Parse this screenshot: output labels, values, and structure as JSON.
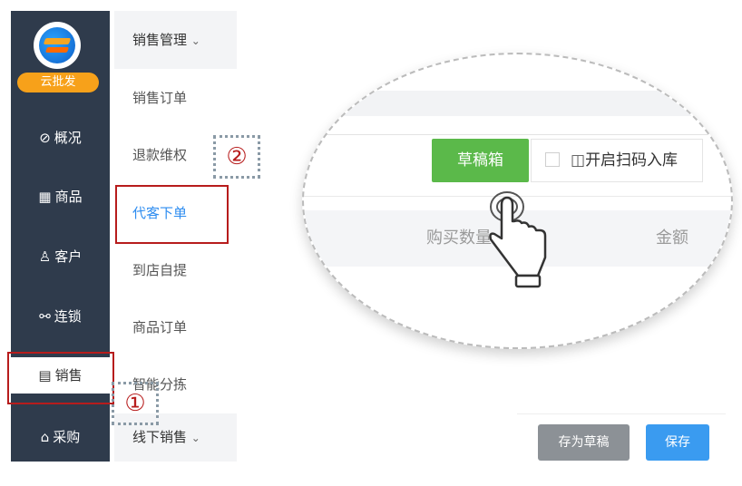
{
  "sidebar": {
    "brand_label": "云批发",
    "items": [
      {
        "label": "概况",
        "icon": "compass-icon",
        "glyph": "⊘"
      },
      {
        "label": "商品",
        "icon": "grid-icon",
        "glyph": "▦"
      },
      {
        "label": "客户",
        "icon": "user-icon",
        "glyph": "♙"
      },
      {
        "label": "连锁",
        "icon": "link-icon",
        "glyph": "⚯"
      },
      {
        "label": "销售",
        "icon": "clipboard-icon",
        "glyph": "▤"
      },
      {
        "label": "采购",
        "icon": "shop-icon",
        "glyph": "⌂"
      }
    ]
  },
  "submenu": {
    "header": "销售管理",
    "items": [
      "销售订单",
      "退款维权",
      "代客下单",
      "到店自提",
      "商品订单",
      "智能分拣"
    ],
    "active": "代客下单",
    "footer": "线下销售"
  },
  "steps": {
    "one": "①",
    "two": "②"
  },
  "zoom_panel": {
    "draft_box_button": "草稿箱",
    "scan_toggle_label": "开启扫码入库",
    "column_quantity": "购买数量",
    "column_amount": "金额"
  },
  "actions": {
    "save_draft": "存为草稿",
    "save": "保存"
  },
  "colors": {
    "sidebar_bg": "#2f3b4c",
    "brand_badge": "#f7a11a",
    "active_link": "#2d8cf0",
    "highlight_box": "#b71c1c",
    "draft_green": "#5bb94a",
    "save_blue": "#3a9bf0",
    "save_draft_grey": "#8c9196"
  }
}
